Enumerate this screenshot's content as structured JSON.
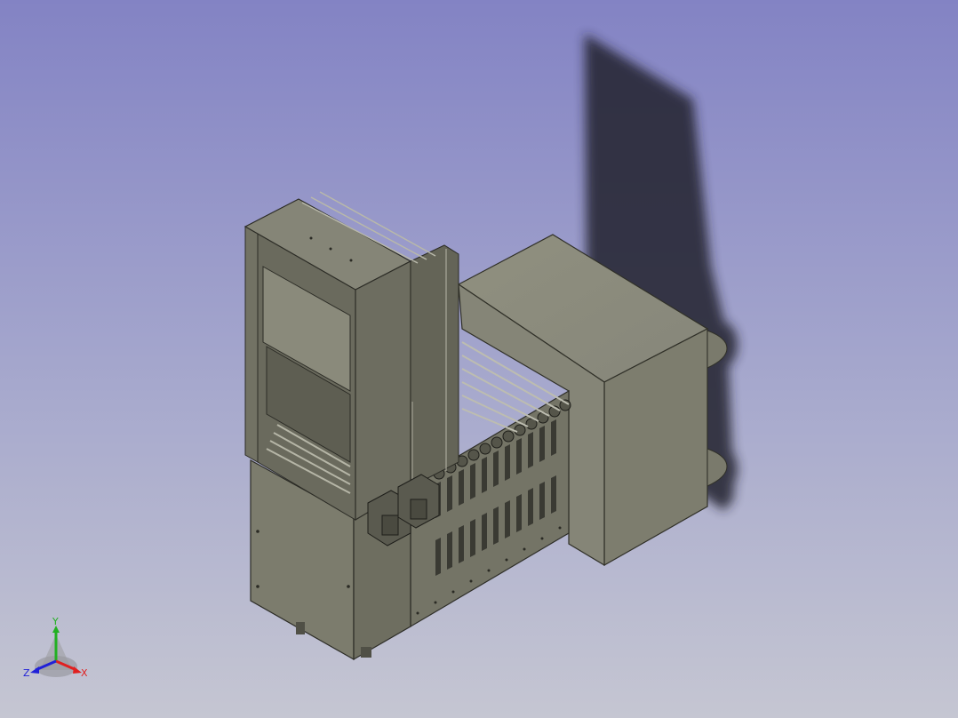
{
  "view": {
    "background_top": "#8383c4",
    "background_bottom": "#c5c6d2",
    "model_color": "#7d7d6e",
    "model_shade": "#666658",
    "model_light": "#8e8e80",
    "shadow_color": "#24242e"
  },
  "triad": {
    "x_label": "X",
    "y_label": "Y",
    "z_label": "Z",
    "x_color": "#e02020",
    "y_color": "#22b022",
    "z_color": "#2020d8"
  }
}
